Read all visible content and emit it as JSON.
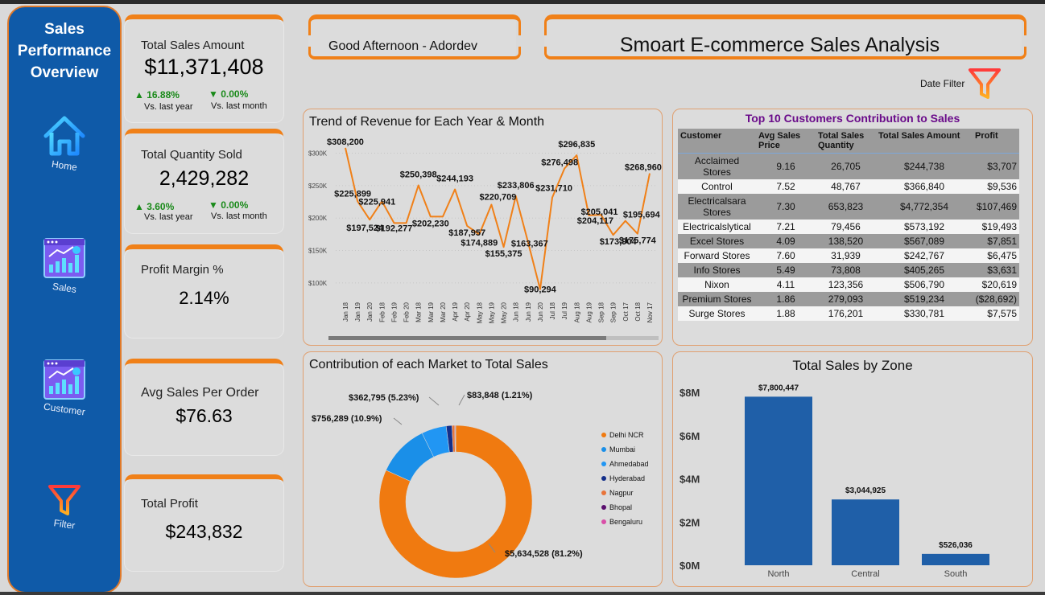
{
  "sidebar": {
    "title_lines": [
      "Sales",
      "Performance",
      "Overview"
    ],
    "items": [
      {
        "label": "Home",
        "icon": "home-icon"
      },
      {
        "label": "Sales",
        "icon": "sales-report-icon"
      },
      {
        "label": "Customer",
        "icon": "customer-report-icon"
      },
      {
        "label": "Filter",
        "icon": "filter-icon"
      }
    ]
  },
  "kpis": {
    "total_sales": {
      "label": "Total Sales Amount",
      "value": "$11,371,408",
      "yoy": "▲ 16.88%",
      "yoy_label": "Vs. last year",
      "mom": "▼ 0.00%",
      "mom_label": "Vs. last month"
    },
    "total_qty": {
      "label": "Total Quantity Sold",
      "value": "2,429,282",
      "yoy": "▲ 3.60%",
      "yoy_label": "Vs. last year",
      "mom": "▼ 0.00%",
      "mom_label": "Vs. last month"
    },
    "profit_margin": {
      "label": "Profit Margin %",
      "value": "2.14%"
    },
    "avg_sales": {
      "label": "Avg Sales Per Order",
      "value": "$76.63"
    },
    "total_profit": {
      "label": "Total Profit",
      "value": "$243,832"
    }
  },
  "header": {
    "greeting": "Good Afternoon - Adordev",
    "title": "Smoart E-commerce Sales Analysis",
    "date_filter_label": "Date Filter"
  },
  "colors": {
    "accent": "#f08018",
    "sidebar": "#0f5aa8",
    "bar": "#1f5fa8",
    "line": "#f08018",
    "table_title": "#6a0b8a"
  },
  "customers_table": {
    "title": "Top 10 Customers Contribution to Sales",
    "headers": [
      "Customer",
      "Avg Sales Price",
      "Total Sales Quantity",
      "Total Sales Amount",
      "Profit"
    ],
    "rows": [
      [
        "Acclaimed Stores",
        "9.16",
        "26,705",
        "$244,738",
        "$3,707"
      ],
      [
        "Control",
        "7.52",
        "48,767",
        "$366,840",
        "$9,536"
      ],
      [
        "Electricalsara Stores",
        "7.30",
        "653,823",
        "$4,772,354",
        "$107,469"
      ],
      [
        "Electricalslytical",
        "7.21",
        "79,456",
        "$573,192",
        "$19,493"
      ],
      [
        "Excel Stores",
        "4.09",
        "138,520",
        "$567,089",
        "$7,851"
      ],
      [
        "Forward Stores",
        "7.60",
        "31,939",
        "$242,767",
        "$6,475"
      ],
      [
        "Info Stores",
        "5.49",
        "73,808",
        "$405,265",
        "$3,631"
      ],
      [
        "Nixon",
        "4.11",
        "123,356",
        "$506,790",
        "$20,619"
      ],
      [
        "Premium Stores",
        "1.86",
        "279,093",
        "$519,234",
        "($28,692)"
      ],
      [
        "Surge Stores",
        "1.88",
        "176,201",
        "$330,781",
        "$7,575"
      ]
    ]
  },
  "chart_data": [
    {
      "type": "line",
      "title": "Trend of Revenue for Each Year & Month",
      "yticks": [
        "$300K",
        "$250K",
        "$200K",
        "$150K",
        "$100K"
      ],
      "ylim": [
        80000,
        318000
      ],
      "x": [
        "Jan 18",
        "Jan 19",
        "Jan 20",
        "Feb 18",
        "Feb 19",
        "Feb 20",
        "Mar 18",
        "Mar 19",
        "Mar 20",
        "Apr 19",
        "Apr 20",
        "May 18",
        "May 19",
        "May 20",
        "Jun 18",
        "Jun 19",
        "Jun 20",
        "Jul 18",
        "Jul 19",
        "Aug 18",
        "Aug 19",
        "Sep 18",
        "Sep 19",
        "Oct 17",
        "Oct 18",
        "Nov 17"
      ],
      "values": [
        308200,
        225899,
        197524,
        225941,
        192277,
        192277,
        250398,
        202230,
        202230,
        244193,
        187957,
        174889,
        220709,
        155375,
        233806,
        163367,
        90294,
        231710,
        276498,
        296835,
        204117,
        205041,
        173904,
        195694,
        175774,
        268960
      ],
      "labels": [
        "$308,200",
        "$225,899",
        "$197,524",
        "$225,941",
        "$192,277",
        "",
        "$250,398",
        "$202,230",
        "",
        "$244,193",
        "$187,957",
        "$174,889",
        "$220,709",
        "$155,375",
        "$233,806",
        "$163,367",
        "$90,294",
        "$231,710",
        "$276,498",
        "$296,835",
        "$204,117",
        "$205,041",
        "$173,904",
        "$195,694",
        "$175,774",
        "$268,960"
      ]
    },
    {
      "type": "pie",
      "title": "Contribution of each Market to Total Sales",
      "categories": [
        "Delhi NCR",
        "Mumbai",
        "Ahmedabad",
        "Hyderabad",
        "Nagpur",
        "Bhopal",
        "Bengaluru"
      ],
      "values": [
        5634528,
        756289,
        362795,
        83848,
        40000,
        8000,
        5000
      ],
      "colors": [
        "#f07a10",
        "#1a8fe8",
        "#2196f3",
        "#142f8a",
        "#e8743a",
        "#5a0e6e",
        "#d94fa8"
      ],
      "slice_labels": [
        "$5,634,528 (81.2%)",
        "$756,289 (10.9%)",
        "$362,795 (5.23%)",
        "$83,848 (1.21%)"
      ]
    },
    {
      "type": "bar",
      "title": "Total Sales by Zone",
      "categories": [
        "North",
        "Central",
        "South"
      ],
      "values": [
        7800447,
        3044925,
        526036
      ],
      "value_labels": [
        "$7,800,447",
        "$3,044,925",
        "$526,036"
      ],
      "yticks": [
        "$8M",
        "$6M",
        "$4M",
        "$2M",
        "$0M"
      ],
      "ylim": [
        0,
        8000000
      ]
    }
  ]
}
